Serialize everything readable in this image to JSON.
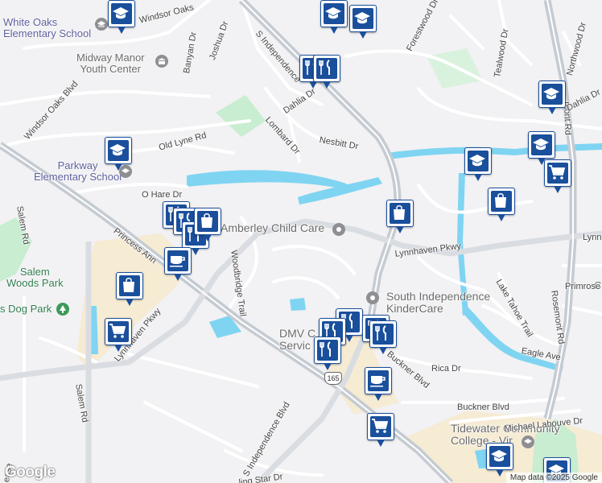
{
  "map": {
    "labels": {
      "white_oaks_school": "White Oaks\nElementary School",
      "midway_manor": "Midway Manor\nYouth Center",
      "parkway_school": "Parkway\nElementary School",
      "amberley": "Amberley Child Care",
      "south_independence": "South Independence\nKinderCare",
      "dmv": "DMV C\nServic",
      "tidewater": "Tidewater Community\nCollege - Vir",
      "salem_woods": "Salem\nWoods Park",
      "dog_park": "s Dog Park",
      "rosemont_partial": "C",
      "primrose_partial": "Primrose"
    },
    "roads": {
      "windsor_oaks_top": "Windsor Oaks",
      "windsor_oaks_blvd": "Windsor Oaks Blvd",
      "s_independence_top": "S Independence",
      "s_independence_bottom": "S Independence Blvd",
      "banyan": "Banyan Dr",
      "joshua": "Joshua Dr",
      "dahlia_center": "Dahlia Dr",
      "lombard": "Lombard Dr",
      "nesbitt": "Nesbitt Dr",
      "old_lyne": "Old Lyne Rd",
      "o_hare": "O Hare Dr",
      "salem_rd_top": "Salem Rd",
      "salem_rd_bottom": "Salem Rd",
      "princess_anne": "Princess Ann",
      "lynnhaven_left": "Lynnhaven Pkwy",
      "lynnhaven_center": "Lynnhaven Pkwy",
      "lynnhaven_right": "Lynn",
      "woodbridge": "Woodbridge Trail",
      "lake_tahoe": "Lake Tahoe Trail",
      "eagle": "Eagle Ave",
      "rosemont": "Rosemont Rd",
      "rosemont_top": "mont Rd",
      "rica": "Rica Dr",
      "buckner_diag": "Buckner Blvd",
      "buckner_flat": "Buckner Blvd",
      "michael_labouve": "Michael Labouve Dr",
      "forestwood": "Forestwood Dr",
      "tealwood": "Tealwood Dr",
      "northwood": "Northwood Dr",
      "dahlia_right": "Dahlia Dr",
      "sterling": "ling Star Dr",
      "route": "165",
      "ease_partial": "ease"
    },
    "attribution": "Map data ©2025 Google",
    "logo": "Google"
  },
  "pins": [
    {
      "type": "school",
      "icon": "graduation-cap-icon"
    },
    {
      "type": "school",
      "icon": "graduation-cap-icon"
    },
    {
      "type": "school",
      "icon": "graduation-cap-icon"
    },
    {
      "type": "school",
      "icon": "graduation-cap-icon"
    },
    {
      "type": "school",
      "icon": "graduation-cap-icon"
    },
    {
      "type": "school",
      "icon": "graduation-cap-icon"
    },
    {
      "type": "school",
      "icon": "graduation-cap-icon"
    },
    {
      "type": "school",
      "icon": "graduation-cap-icon"
    },
    {
      "type": "school",
      "icon": "graduation-cap-icon"
    },
    {
      "type": "restaurant",
      "icon": "fork-knife-icon"
    },
    {
      "type": "restaurant",
      "icon": "fork-knife-icon"
    },
    {
      "type": "restaurant",
      "icon": "fork-knife-icon"
    },
    {
      "type": "restaurant",
      "icon": "fork-knife-icon"
    },
    {
      "type": "restaurant",
      "icon": "fork-knife-icon"
    },
    {
      "type": "restaurant",
      "icon": "fork-knife-icon"
    },
    {
      "type": "restaurant",
      "icon": "fork-knife-icon"
    },
    {
      "type": "restaurant",
      "icon": "fork-knife-icon"
    },
    {
      "type": "restaurant",
      "icon": "fork-knife-icon"
    },
    {
      "type": "restaurant",
      "icon": "fork-knife-icon"
    },
    {
      "type": "shopping",
      "icon": "shopping-bag-icon"
    },
    {
      "type": "shopping",
      "icon": "shopping-bag-icon"
    },
    {
      "type": "shopping",
      "icon": "shopping-bag-icon"
    },
    {
      "type": "shopping",
      "icon": "shopping-bag-icon"
    },
    {
      "type": "grocery",
      "icon": "shopping-cart-icon"
    },
    {
      "type": "grocery",
      "icon": "shopping-cart-icon"
    },
    {
      "type": "grocery",
      "icon": "shopping-cart-icon"
    },
    {
      "type": "cafe",
      "icon": "coffee-cup-icon"
    },
    {
      "type": "cafe",
      "icon": "coffee-cup-icon"
    }
  ],
  "colors": {
    "land": "#f2f1f3",
    "water": "#7fd4f2",
    "park": "#c8edd0",
    "commercial": "#f6ebd3",
    "major_road": "#c5cbd2",
    "minor_road": "#ffffff",
    "pin_blue": "#1a4f9c"
  }
}
